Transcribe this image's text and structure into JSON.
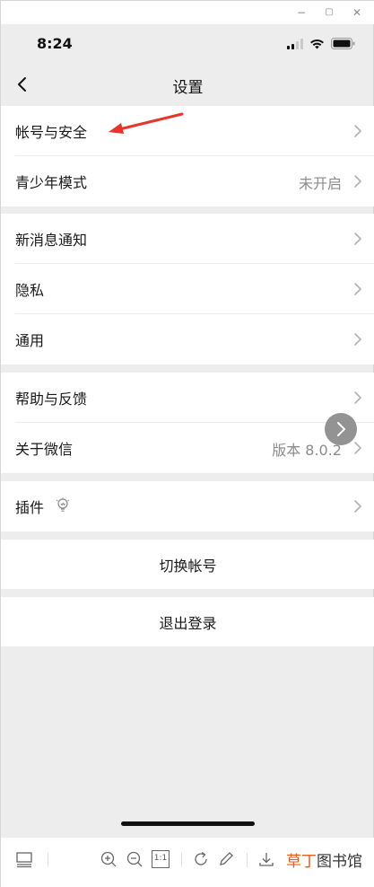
{
  "window": {
    "controls": {
      "minimize": "−",
      "maximize": "▢",
      "close": "✕"
    }
  },
  "status_bar": {
    "time": "8:24",
    "icons": [
      "signal-icon",
      "wifi-icon",
      "battery-icon"
    ]
  },
  "nav": {
    "title": "设置",
    "back_icon": "chevron-left-icon"
  },
  "groups": [
    {
      "rows": [
        {
          "label": "帐号与安全",
          "value": ""
        },
        {
          "label": "青少年模式",
          "value": "未开启"
        }
      ]
    },
    {
      "rows": [
        {
          "label": "新消息通知",
          "value": ""
        },
        {
          "label": "隐私",
          "value": ""
        },
        {
          "label": "通用",
          "value": ""
        }
      ]
    },
    {
      "rows": [
        {
          "label": "帮助与反馈",
          "value": ""
        },
        {
          "label": "关于微信",
          "value": "版本 8.0.2"
        }
      ]
    },
    {
      "rows": [
        {
          "label": "插件",
          "value": "",
          "icon": "lightbulb-icon"
        }
      ]
    }
  ],
  "actions": {
    "switch_account": "切换帐号",
    "logout": "退出登录"
  },
  "annotation": {
    "arrow_color": "#e8352b"
  },
  "toolbar": {
    "icons": [
      "layout-icon",
      "zoom-in-icon",
      "zoom-out-icon",
      "actual-size-icon",
      "rotate-icon",
      "edit-icon",
      "download-icon"
    ],
    "actual_size_label": "1:1",
    "brand_accent": "草丁",
    "brand_rest": "图书馆",
    "brand_color": "#e85d1a"
  }
}
